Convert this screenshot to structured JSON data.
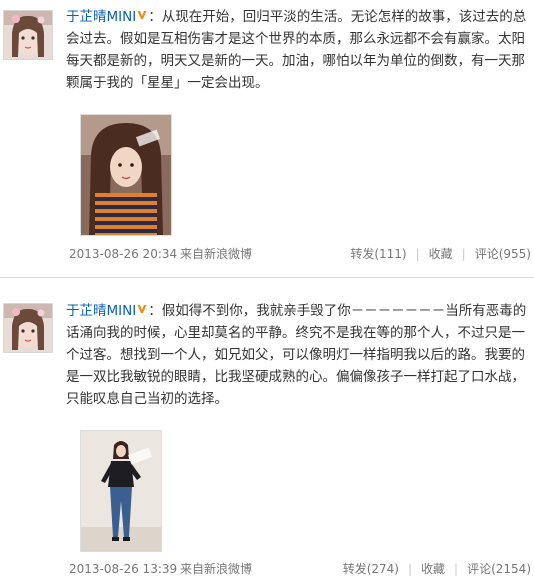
{
  "posts": [
    {
      "author": "于芷晴MINI",
      "separator": "：",
      "text": "从现在开始，回归平淡的生活。无论怎样的故事，该过去的总会过去。假如是互相伤害才是这个世界的本质，那么永远都不会有赢家。太阳每天都是新的，明天又是新的一天。加油，哪怕以年为单位的倒数，有一天那颗属于我的「星星」一定会出现。",
      "time": "2013-08-26 20:34",
      "source": "来自新浪微博",
      "repost": "转发(111)",
      "favorite": "收藏",
      "comment": "评论(955)"
    },
    {
      "author": "于芷晴MINI",
      "separator": "：",
      "text": "假如得不到你，我就亲手毁了你－－－－－－－当所有恶毒的话涌向我的时候，心里却莫名的平静。终究不是我在等的那个人，不过只是一个过客。想找到一个人，如兄如父，可以像明灯一样指明我以后的路。我要的是一双比我敏锐的眼睛，比我坚硬成熟的心。偏偏像孩子一样打起了口水战，只能叹息自己当初的选择。",
      "time": "2013-08-26 13:39",
      "source": "来自新浪微博",
      "repost": "转发(274)",
      "favorite": "收藏",
      "comment": "评论(2154)"
    }
  ],
  "colors": {
    "link": "#0a5fb0",
    "meta_text": "#777777",
    "body_text": "#333333",
    "vip_badge": "#f08a1c",
    "divider": "#dcdcdc"
  },
  "icons": {
    "verified_badge": "v-badge-icon"
  }
}
